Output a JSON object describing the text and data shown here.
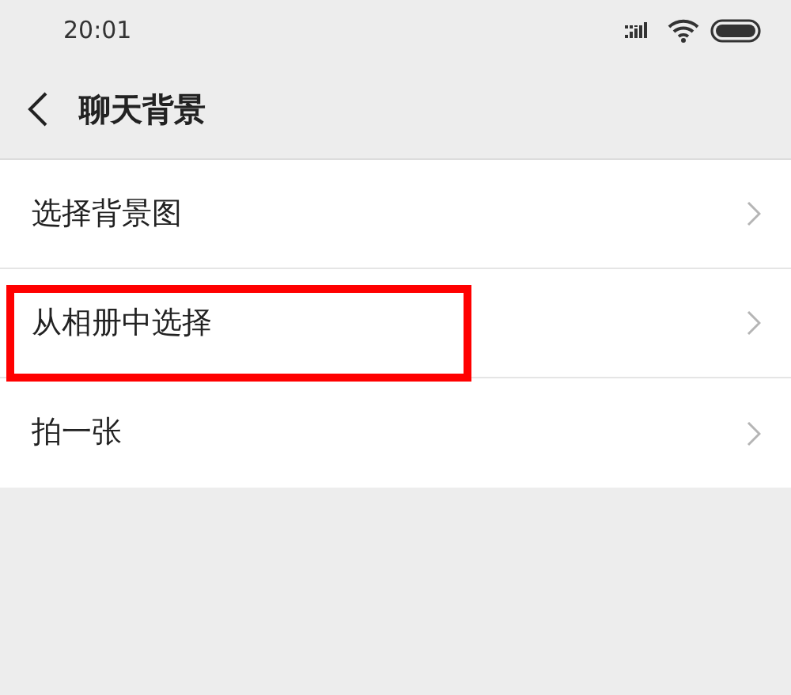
{
  "status_bar": {
    "time": "20:01"
  },
  "header": {
    "title": "聊天背景"
  },
  "items": [
    {
      "label": "选择背景图",
      "highlighted": false
    },
    {
      "label": "从相册中选择",
      "highlighted": true
    },
    {
      "label": "拍一张",
      "highlighted": false
    }
  ]
}
